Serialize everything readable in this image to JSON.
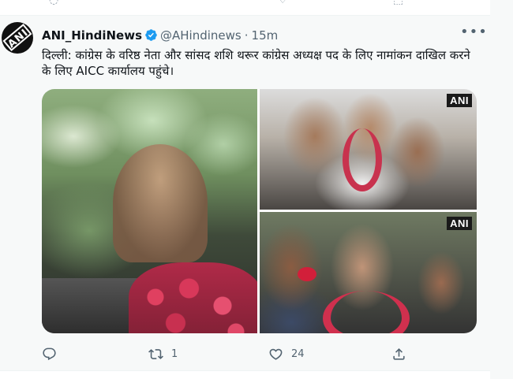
{
  "tweet": {
    "display_name": "ANI_HindiNews",
    "handle": "@AHindinews",
    "separator": "·",
    "time": "15m",
    "more": "•••",
    "text": "दिल्ली: कांग्रेस के वरिष्ठ नेता और सांसद शशि थरूर कांग्रेस अध्यक्ष पद के लिए नामांकन दाखिल करने के लिए AICC कार्यालय पहुंचे।",
    "avatar_text": "ANI",
    "media": [
      {
        "name": "car-photo",
        "watermark": ""
      },
      {
        "name": "crowd-photo-1",
        "watermark": "ANI"
      },
      {
        "name": "crowd-photo-2",
        "watermark": "ANI"
      }
    ],
    "actions": {
      "reply_count": "",
      "retweet_count": "1",
      "like_count": "24"
    }
  },
  "colors": {
    "verified": "#1d9bf0",
    "secondary_text": "#536471",
    "garland_red": "#c8324e"
  }
}
